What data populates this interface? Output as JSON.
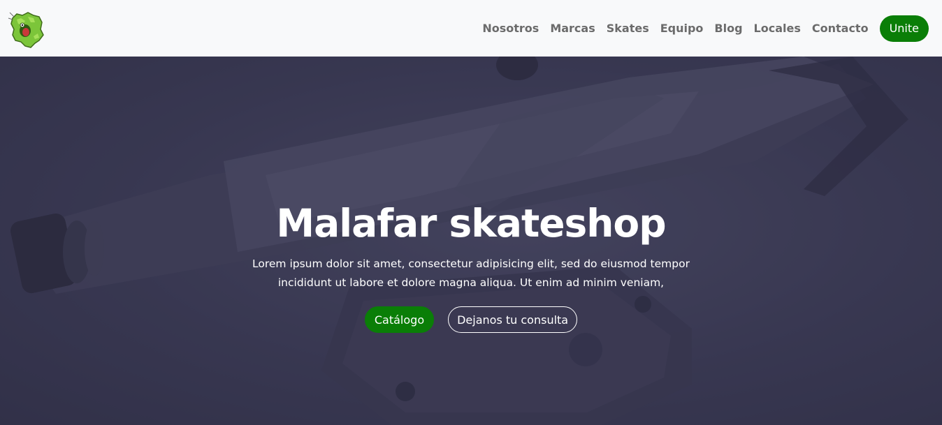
{
  "brand": {
    "logo_icon": "green-splat-mascot-icon"
  },
  "nav": {
    "links": [
      "Nosotros",
      "Marcas",
      "Skates",
      "Equipo",
      "Blog",
      "Locales",
      "Contacto"
    ],
    "cta_label": "Unite"
  },
  "hero": {
    "title": "Malafar skateshop",
    "text": "Lorem ipsum dolor sit amet, consectetur adipisicing elit, sed do eiusmod tempor incididunt ut labore et dolore magna aliqua. Ut enim ad minim veniam,",
    "primary_button": "Catálogo",
    "secondary_button": "Dejanos tu consulta",
    "background_image": "skateboard-truck-photo"
  },
  "colors": {
    "accent_green": "#0a7e07",
    "navbar_bg": "#f8f9fa",
    "nav_link": "#6b6b6b",
    "hero_overlay": "#3b3a55"
  }
}
